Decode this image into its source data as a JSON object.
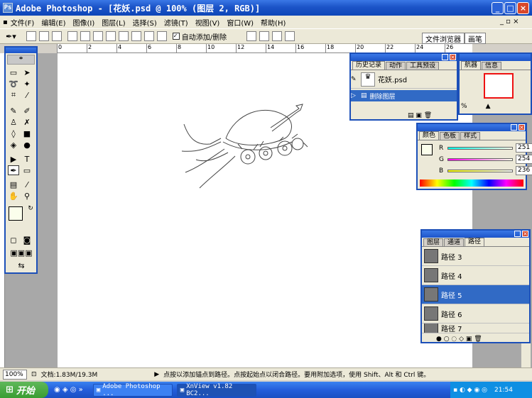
{
  "window": {
    "title": "Adobe Photoshop - [花妖.psd @ 100% (图层 2, RGB)]"
  },
  "menu": [
    "文件(F)",
    "编辑(E)",
    "图像(I)",
    "图层(L)",
    "选择(S)",
    "滤镜(T)",
    "视图(V)",
    "窗口(W)",
    "帮助(H)"
  ],
  "options": {
    "auto_add_delete_label": "自动添加/删除",
    "file_browser_tab": "文件浏览器",
    "brushes_tab": "画笔"
  },
  "ruler_ticks": [
    "0",
    "2",
    "4",
    "6",
    "8",
    "10",
    "12",
    "14",
    "16",
    "18",
    "20",
    "22",
    "24",
    "26"
  ],
  "history": {
    "tabs": [
      "历史记录",
      "动作",
      "工具预设"
    ],
    "snapshot": "花妖.psd",
    "step": "删除图层"
  },
  "navigator": {
    "tabs": [
      "航器",
      "信息"
    ],
    "zoom": "%"
  },
  "color": {
    "tabs": [
      "颜色",
      "色板",
      "样式"
    ],
    "r_label": "R",
    "g_label": "G",
    "b_label": "B",
    "r": "251",
    "g": "254",
    "b": "236"
  },
  "paths": {
    "tabs": [
      "图层",
      "通道",
      "路径"
    ],
    "items": [
      "路径 3",
      "路径 4",
      "路径 5",
      "路径 6",
      "路径 7"
    ],
    "selected": "路径 5"
  },
  "status": {
    "zoom": "100%",
    "doc": "文档:1.83M/19.3M",
    "hint": "点按以添加锚点到路径。点按起始点以闭合路径。要用附加选项，使用 Shift、Alt 和 Ctrl 键。"
  },
  "taskbar": {
    "start": "开始",
    "items": [
      "Adobe Photoshop ...",
      "XnView v1.82 BC2..."
    ],
    "clock": "21:54"
  },
  "colors": {
    "title_blue": "#1c54c8",
    "selected_row": "#316ac5",
    "fg_swatch": "#fbfeec"
  }
}
